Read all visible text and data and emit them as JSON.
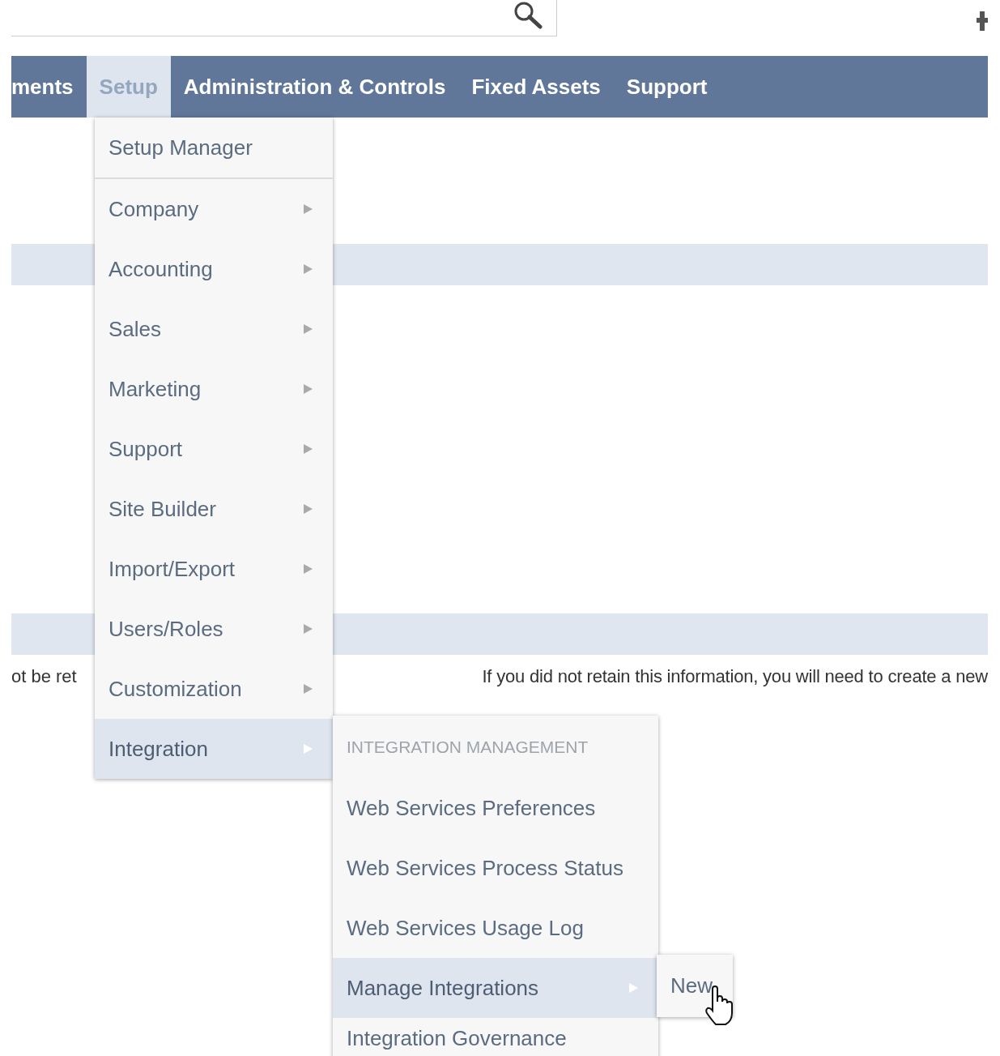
{
  "nav": {
    "tabs": [
      {
        "label": "ments",
        "selected": false
      },
      {
        "label": "Setup",
        "selected": true
      },
      {
        "label": "Administration & Controls",
        "selected": false
      },
      {
        "label": "Fixed Assets",
        "selected": false
      },
      {
        "label": "Support",
        "selected": false
      }
    ]
  },
  "page": {
    "left_fragment": "ot be ret",
    "right_text": "If you did not retain this information, you will need to create a new"
  },
  "setup_menu": {
    "items": [
      {
        "label": "Setup Manager",
        "kind": "link",
        "selected": false
      },
      {
        "label": "Company",
        "kind": "submenu",
        "selected": false
      },
      {
        "label": "Accounting",
        "kind": "submenu",
        "selected": false
      },
      {
        "label": "Sales",
        "kind": "submenu",
        "selected": false
      },
      {
        "label": "Marketing",
        "kind": "submenu",
        "selected": false
      },
      {
        "label": "Support",
        "kind": "submenu",
        "selected": false
      },
      {
        "label": "Site Builder",
        "kind": "submenu",
        "selected": false
      },
      {
        "label": "Import/Export",
        "kind": "submenu",
        "selected": false
      },
      {
        "label": "Users/Roles",
        "kind": "submenu",
        "selected": false
      },
      {
        "label": "Customization",
        "kind": "submenu",
        "selected": false
      },
      {
        "label": "Integration",
        "kind": "submenu",
        "selected": true
      }
    ]
  },
  "integration_menu": {
    "items": [
      {
        "label": "INTEGRATION MANAGEMENT",
        "kind": "header"
      },
      {
        "label": "Web Services Preferences",
        "kind": "link",
        "selected": false
      },
      {
        "label": "Web Services Process Status",
        "kind": "link",
        "selected": false
      },
      {
        "label": "Web Services Usage Log",
        "kind": "link",
        "selected": false
      },
      {
        "label": "Manage Integrations",
        "kind": "submenu",
        "selected": true
      },
      {
        "label": "Integration Governance",
        "kind": "link",
        "selected": false
      }
    ]
  },
  "manage_menu": {
    "items": [
      {
        "label": "New",
        "selected": false
      }
    ]
  }
}
